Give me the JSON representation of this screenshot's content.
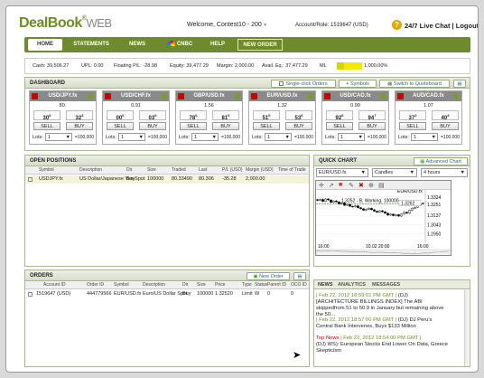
{
  "header": {
    "logo_main": "DealBook",
    "logo_reg": "®",
    "logo_web": "WEB",
    "welcome": "Welcome, Contest10 - 200",
    "account": "Account/Role: 1519647 (USD)",
    "live_chat": "24/7 Live Chat",
    "separator": "|",
    "logout": "Logout"
  },
  "nav": {
    "home": "HOME",
    "statements": "STATEMENTS",
    "news": "NEWS",
    "cnbc": "CNBC",
    "help": "HELP",
    "new_order": "NEW ORDER"
  },
  "stats": {
    "cash": "Cash: 39,506.27",
    "upl": "UPL: 0.00",
    "floating": "Floating P/L: -28.98",
    "equity": "Equity: 39,477.29",
    "margin": "Margin: 2,000.00",
    "avail": "Avail. Eq.: 37,477.29",
    "ml_label": "ML",
    "ml_value": "1,000.00%",
    "ml_level": 0.2
  },
  "dashboard": {
    "title": "DASHBOARD",
    "single_click": "Single-click Orders",
    "symbols": "Symbols",
    "quoteboard": "Switch to Quoteboard",
    "tiles": [
      {
        "pair": "USD/JPY.fx",
        "spread": "80.",
        "bid": "30",
        "bid_sup": "6",
        "ask": "32",
        "ask_sup": "3",
        "sell": "SELL",
        "buy": "BUY",
        "lots_label": "Lots:",
        "lots": "1",
        "amount": "=100,000"
      },
      {
        "pair": "USD/CHF.fx",
        "spread": "0.91",
        "bid": "00",
        "bid_sup": "6",
        "ask": "03",
        "ask_sup": "0",
        "sell": "SELL",
        "buy": "BUY",
        "lots_label": "Lots:",
        "lots": "1",
        "amount": "=100,000"
      },
      {
        "pair": "GBP/USD.fx",
        "spread": "1.56",
        "bid": "78",
        "bid_sup": "6",
        "ask": "81",
        "ask_sup": "6",
        "sell": "SELL",
        "buy": "BUY",
        "lots_label": "Lots:",
        "lots": "1",
        "amount": "=100,000"
      },
      {
        "pair": "EUR/USD.fx",
        "spread": "1.32",
        "bid": "51",
        "bid_sup": "6",
        "ask": "53",
        "ask_sup": "6",
        "sell": "SELL",
        "buy": "BUY",
        "lots_label": "Lots:",
        "lots": "1",
        "amount": "=100,000"
      },
      {
        "pair": "USD/CAD.fx",
        "spread": "0.99",
        "bid": "92",
        "bid_sup": "6",
        "ask": "94",
        "ask_sup": "7",
        "sell": "SELL",
        "buy": "BUY",
        "lots_label": "Lots:",
        "lots": "1",
        "amount": "=100,000"
      },
      {
        "pair": "AUD/CAD.fx",
        "spread": "1.07",
        "bid": "37",
        "bid_sup": "2",
        "ask": "40",
        "ask_sup": "4",
        "sell": "SELL",
        "buy": "BUY",
        "lots_label": "Lots:",
        "lots": "1",
        "amount": "=100,000"
      }
    ]
  },
  "positions": {
    "title": "OPEN POSITIONS",
    "columns": [
      "Symbol",
      "Description",
      "Dir",
      "Size",
      "Traded",
      "Last",
      "P/L (USD)",
      "Margin (USD)",
      "Time of Trade"
    ],
    "rows": [
      [
        "USDJPY.fx",
        "US Dollar/Japanese Yen Spot",
        "Buy",
        "100000",
        "80.33490",
        "80.306",
        "-35.28",
        "2,000.00",
        ""
      ]
    ]
  },
  "orders": {
    "title": "ORDERS",
    "new_order": "New Order",
    "columns": [
      "Account ID",
      "Order ID",
      "Symbol",
      "Description",
      "Dir",
      "Size",
      "Price",
      "Type",
      "Status",
      "Parent ID",
      "OCO ID"
    ],
    "rows": [
      [
        "1519647 (USD)",
        "444779566",
        "EUR/USD.fx",
        "Euro/US Dollar Spot",
        "Buy",
        "100000",
        "1.32520",
        "Limit",
        "W",
        "0",
        "0"
      ]
    ]
  },
  "quick_chart": {
    "title": "QUICK CHART",
    "advanced": "Advanced Chart",
    "symbol": "EUR/USD.fx",
    "type": "Candles",
    "period": "4 hours",
    "symbol_label": "EUR/USD.fx",
    "order_label": "1.3252 - B, Working, 100000",
    "x_ticks": [
      "16:00",
      "10.02 20:00",
      "16:00"
    ],
    "y_ticks": [
      "1.3324",
      "1.3251",
      "1.3137",
      "1.3043",
      "1.2950"
    ],
    "price_tag": "1.3262"
  },
  "chart_data": {
    "type": "candlestick",
    "ylim": [
      1.29,
      1.336
    ],
    "x_labels": [
      "16:00",
      "10.02 20:00",
      "16:00"
    ],
    "closes": [
      1.329,
      1.33,
      1.328,
      1.3305,
      1.3295,
      1.327,
      1.3285,
      1.3275,
      1.3255,
      1.3265,
      1.324,
      1.325,
      1.323,
      1.3225,
      1.3235,
      1.3215,
      1.3205,
      1.319,
      1.32,
      1.321,
      1.3195,
      1.318,
      1.317,
      1.3185,
      1.3175,
      1.316,
      1.314,
      1.315,
      1.3135,
      1.3145,
      1.313,
      1.315,
      1.317,
      1.316,
      1.319,
      1.321,
      1.322,
      1.324,
      1.3255,
      1.3262
    ]
  },
  "news_tabs": {
    "news": "NEWS",
    "analytics": "ANALYTICS",
    "messages": "MESSAGES"
  },
  "news": [
    {
      "ts": "| Feb 22, 2012 18:59:01 PM GMT |",
      "src": "(DJ)",
      "text": "[ARCHITECTURE BILLINGS INDEX] The ABI skippedfrom 51 to 50.9 in January but remaining above the 50..."
    },
    {
      "ts": "| Feb 22, 2012 18:57:00 PM GMT |",
      "src": "(DJ) DJ Peru's",
      "text": "Central Bank Intervenes, Buys $133 Million"
    },
    {
      "ts": "| Feb 22, 2012 18:54:00 PM GMT |",
      "top": "Top News",
      "src": "",
      "text": "(DJ) WS): European Stocks End Lower On Data, Greece Skepticism"
    }
  ]
}
